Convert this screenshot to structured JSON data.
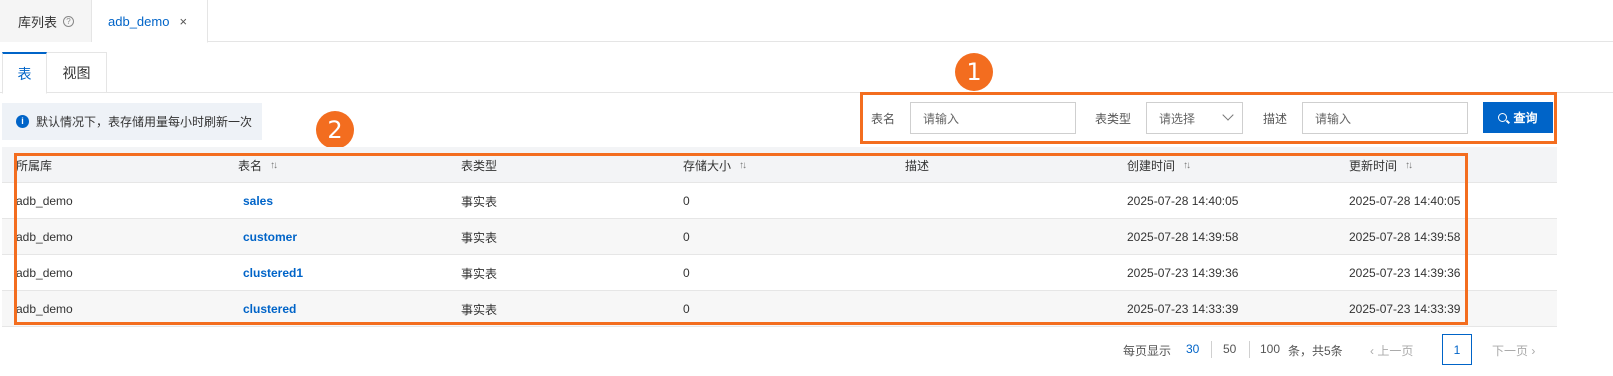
{
  "top_tabs": [
    {
      "label": "库列表"
    },
    {
      "label": "adb_demo",
      "close": "×"
    }
  ],
  "sub_tabs": [
    {
      "label": "表",
      "active": true
    },
    {
      "label": "视图",
      "active": false
    }
  ],
  "notice": {
    "icon": "info-icon",
    "text": "默认情况下，表存储用量每小时刷新一次"
  },
  "callouts": [
    "1",
    "2"
  ],
  "filters": {
    "name_label": "表名",
    "name_placeholder": "请输入",
    "type_label": "表类型",
    "type_value": "请选择",
    "desc_label": "描述",
    "desc_placeholder": "请输入",
    "search_label": "查询"
  },
  "table": {
    "columns": [
      "所属库",
      "表名",
      "表类型",
      "存储大小",
      "描述",
      "创建时间",
      "更新时间"
    ],
    "sortable": [
      false,
      true,
      false,
      true,
      false,
      true,
      true
    ],
    "rows": [
      [
        "adb_demo",
        "sales",
        "事实表",
        "0",
        "",
        "2025-07-28 14:40:05",
        "2025-07-28 14:40:05"
      ],
      [
        "adb_demo",
        "customer",
        "事实表",
        "0",
        "",
        "2025-07-28 14:39:58",
        "2025-07-28 14:39:58"
      ],
      [
        "adb_demo",
        "clustered1",
        "事实表",
        "0",
        "",
        "2025-07-23 14:39:36",
        "2025-07-23 14:39:36"
      ],
      [
        "adb_demo",
        "clustered",
        "事实表",
        "0",
        "",
        "2025-07-23 14:33:39",
        "2025-07-23 14:33:39"
      ]
    ]
  },
  "pagination": {
    "per_page_label": "每页显示",
    "sizes": [
      "30",
      "50",
      "100"
    ],
    "active_size": "30",
    "total_text": "条，共5条",
    "prev_label": "上一页",
    "current_page": "1",
    "next_label": "下一页"
  },
  "colors": {
    "accent": "#0064c8",
    "callout": "#f36d1f"
  }
}
